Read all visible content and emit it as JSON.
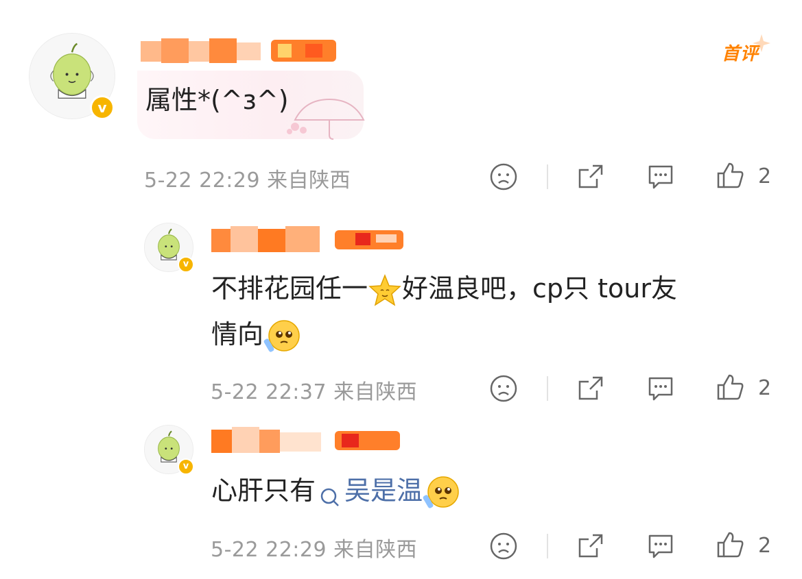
{
  "comments": [
    {
      "text": "属性*(^ɜ^)",
      "badge": "首评",
      "meta": "5-22 22:29 来自陕西",
      "likes": "2"
    },
    {
      "text_line1": "不排花园任一",
      "text_line1b": "好温良吧，cp只 tour友",
      "text_line2": "情向",
      "meta": "5-22 22:37 来自陕西",
      "likes": "2"
    },
    {
      "text_prefix": "心肝只有",
      "topic": "吴是温",
      "meta": "5-22 22:29 来自陕西",
      "likes": "2"
    }
  ],
  "colors": {
    "accent": "#ff8200",
    "verified": "#f7b500",
    "link": "#4d6fa8",
    "meta": "#9a9a9a"
  },
  "icons": [
    "dislike-icon",
    "share-icon",
    "comment-icon",
    "like-icon",
    "search-icon",
    "verified-icon"
  ]
}
